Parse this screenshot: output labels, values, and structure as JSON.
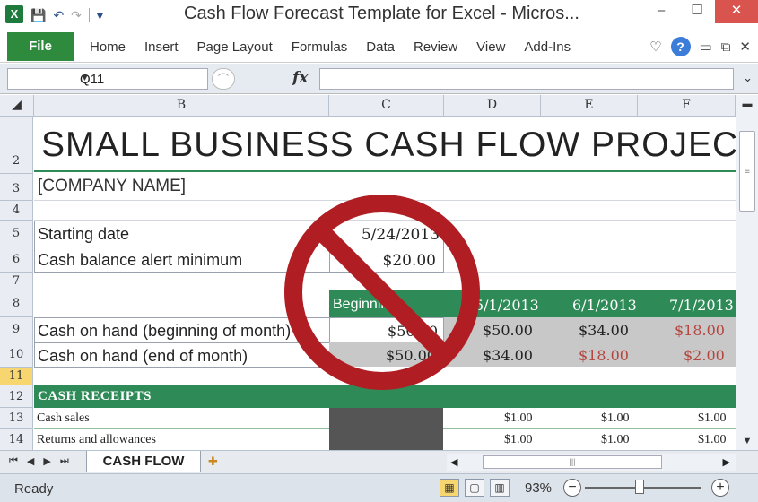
{
  "window": {
    "title": "Cash Flow Forecast Template for Excel  -  Micros...",
    "app_icon": "X",
    "controls": {
      "minimize": "–",
      "maximize": "☐",
      "close": "✕"
    }
  },
  "qat": {
    "save": "💾",
    "undo": "↶",
    "redo": "↷",
    "customize": "▾"
  },
  "ribbon": {
    "file_label": "File",
    "tabs": [
      "Home",
      "Insert",
      "Page Layout",
      "Formulas",
      "Data",
      "Review",
      "View",
      "Add-Ins"
    ],
    "help": "?"
  },
  "formula_bar": {
    "name_box": "Q11",
    "fx": "fx",
    "formula": ""
  },
  "columns": [
    "B",
    "C",
    "D",
    "E",
    "F"
  ],
  "rows": [
    "2",
    "3",
    "4",
    "5",
    "6",
    "7",
    "8",
    "9",
    "10",
    "11",
    "12",
    "13",
    "14"
  ],
  "sheet": {
    "title": "SMALL BUSINESS CASH FLOW PROJECT",
    "company": "[COMPANY NAME]",
    "starting_date_label": "Starting date",
    "starting_date_value": "5/24/2013",
    "alert_label": "Cash balance alert minimum",
    "alert_value": "$20.00",
    "header_row": {
      "c": "Beginning",
      "d": "5/1/2013",
      "e": "6/1/2013",
      "f": "7/1/2013"
    },
    "row9": {
      "label": "Cash on hand (beginning of month)",
      "c": "$50.00",
      "d": "$50.00",
      "e": "$34.00",
      "f": "$18.00"
    },
    "row10": {
      "label": "Cash on hand (end of month)",
      "c": "$50.00",
      "d": "$34.00",
      "e": "$18.00",
      "f": "$2.00"
    },
    "receipts_label": "CASH RECEIPTS",
    "row13": {
      "label": "Cash sales",
      "d": "$1.00",
      "e": "$1.00",
      "f": "$1.00"
    },
    "row14": {
      "label": "Returns and allowances",
      "d": "$1.00",
      "e": "$1.00",
      "f": "$1.00"
    }
  },
  "sheet_tabs": {
    "active": "CASH FLOW"
  },
  "status": {
    "text": "Ready",
    "zoom": "93%"
  },
  "colors": {
    "accent_green": "#2e8b57",
    "alert_red": "#b5463f",
    "no_sign": "#b01e24"
  }
}
